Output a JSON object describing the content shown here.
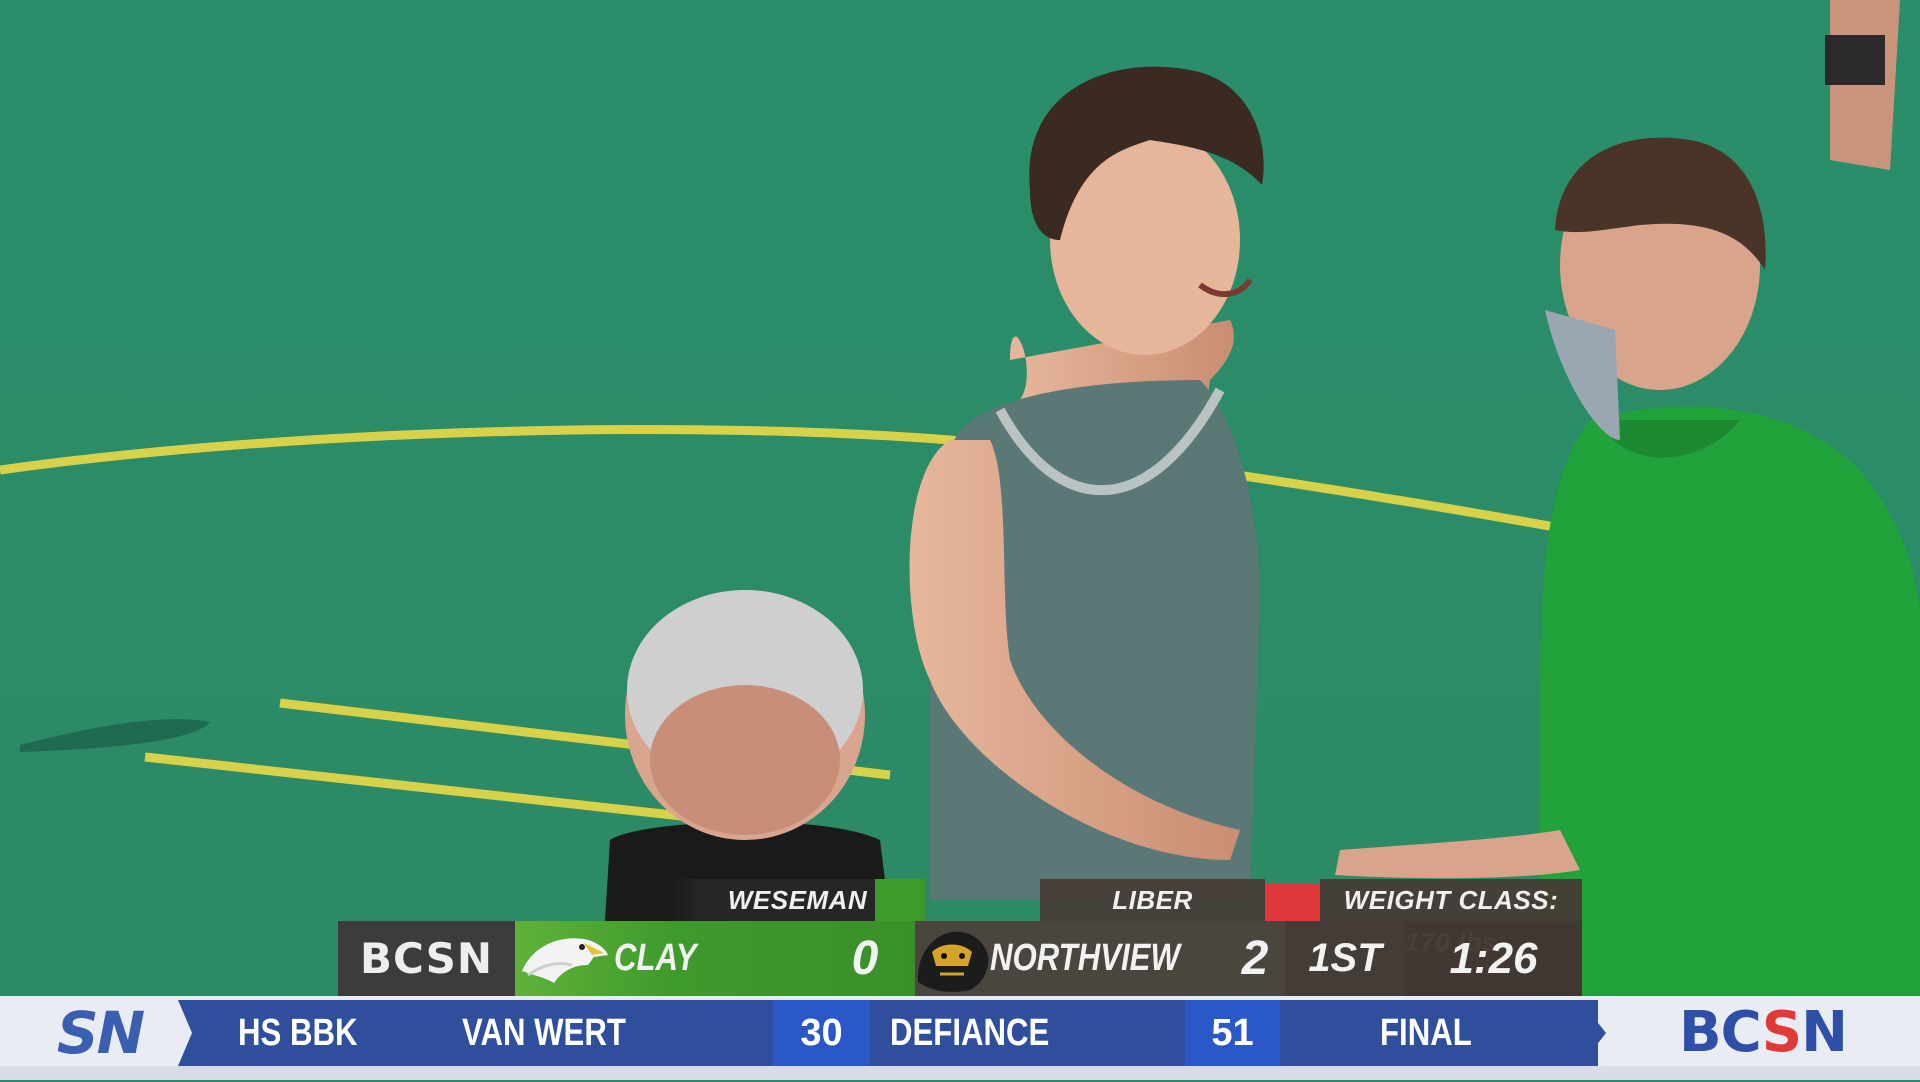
{
  "scorebug": {
    "network": "BCSN",
    "team_a": {
      "wrestler": "WESEMAN",
      "name": "CLAY",
      "score": "0",
      "color": "#3f9a2c",
      "logo_icon": "eagle-icon"
    },
    "team_b": {
      "wrestler": "LIBER",
      "name": "NORTHVIEW",
      "score": "2",
      "color": "#5a4a46",
      "logo_icon": "cougar-icon"
    },
    "weight_class": "WEIGHT CLASS: 170 lbs",
    "period": "1ST",
    "clock": "1:26",
    "indicator_color": "#e0373a"
  },
  "ticker": {
    "left_logo": "SN",
    "sport": "HS BBK",
    "team_a": "VAN WERT",
    "score_a": "30",
    "team_b": "DEFIANCE",
    "score_b": "51",
    "status": "FINAL",
    "right_logo_parts": [
      "BC",
      "S",
      "N"
    ],
    "colors": {
      "bar": "#2f4f9c",
      "score_box": "#2b58c9",
      "logo_blue": "#2d4fa8",
      "logo_red": "#e03a36"
    }
  }
}
